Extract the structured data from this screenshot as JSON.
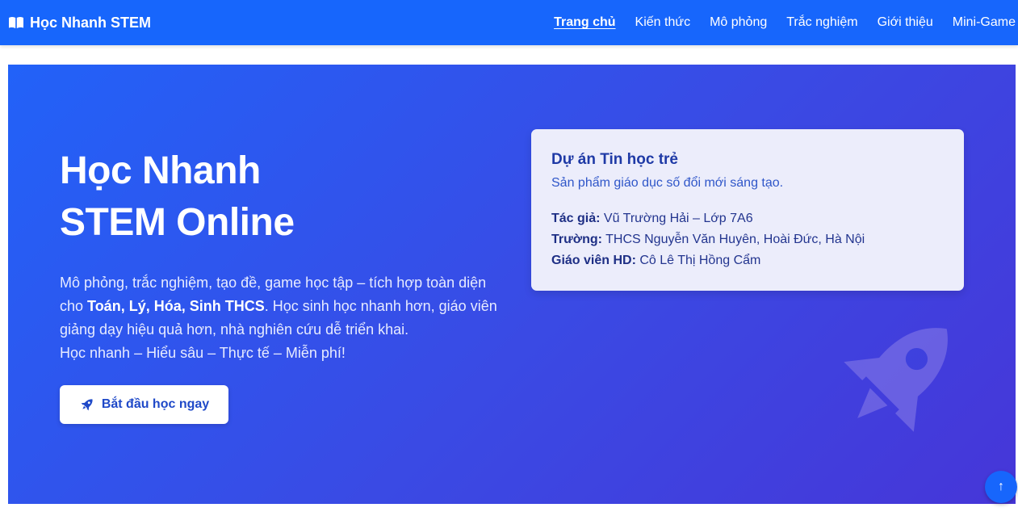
{
  "navbar": {
    "brand": "Học Nhanh STEM",
    "brand_icon": "open-book-icon",
    "links": [
      {
        "label": "Trang chủ",
        "active": true
      },
      {
        "label": "Kiến thức"
      },
      {
        "label": "Mô phỏng"
      },
      {
        "label": "Trắc nghiệm"
      },
      {
        "label": "Giới thiệu"
      },
      {
        "label": "Mini-Game"
      }
    ],
    "color": "#1766fc"
  },
  "hero": {
    "title_line1": "Học Nhanh",
    "title_line2": "STEM Online",
    "desc_part1": "Mô phỏng, trắc nghiệm, tạo đề, game học tập – tích hợp toàn diện cho ",
    "desc_bold": "Toán, Lý, Hóa, Sinh THCS",
    "desc_part2": ". Học sinh học nhanh hơn, giáo viên giảng dạy hiệu quả hơn, nhà nghiên cứu dễ triển khai.",
    "desc_line2": "Học nhanh – Hiểu sâu – Thực tế – Miễn phí!",
    "cta_label": "Bắt đầu học ngay",
    "cta_icon": "rocket-icon",
    "decor_icon": "rocket-icon",
    "gradient": [
      "#2262f8",
      "#4636d8"
    ]
  },
  "card": {
    "title": "Dự án Tin học trẻ",
    "subtitle": "Sản phẩm giáo dục số đổi mới sáng tạo.",
    "author_label": "Tác giả:",
    "author_value": " Vũ Trường Hải – Lớp 7A6",
    "school_label": "Trường:",
    "school_value": " THCS Nguyễn Văn Huyên, Hoài Đức, Hà Nội",
    "teacher_label": "Giáo viên HD:",
    "teacher_value": " Cô Lê Thị Hồng Cẩm"
  },
  "scroll_top": {
    "label": "↑",
    "icon": "arrow-up-icon"
  }
}
